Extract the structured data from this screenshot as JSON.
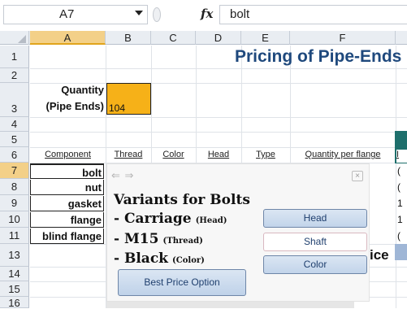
{
  "formula_bar": {
    "name_box": "A7",
    "fx_label": "fx",
    "formula_value": "bolt"
  },
  "columns": [
    "A",
    "B",
    "C",
    "D",
    "E",
    "F"
  ],
  "rows": [
    "1",
    "2",
    "3",
    "4",
    "5",
    "6",
    "7",
    "8",
    "9",
    "10",
    "11",
    "13",
    "14",
    "15",
    "16"
  ],
  "sheet": {
    "title": "Pricing of Pipe-Ends",
    "quantity_label_line1": "Quantity",
    "quantity_label_line2": "(Pipe Ends)",
    "quantity_value": "104",
    "component_headers": [
      "Component",
      "Thread",
      "Color",
      "Head",
      "Type",
      "Quantity per flange"
    ],
    "right_col_header_partial": "I",
    "components": [
      "bolt",
      "nut",
      "gasket",
      "flange",
      "blind flange"
    ],
    "right_col_digits": [
      "(",
      "(",
      "1",
      "1",
      "("
    ],
    "price_partial": "ice"
  },
  "popup": {
    "nav_arrows": "⇐ ⇒",
    "close_label": "×",
    "heading": "Variants for Bolts",
    "variants": [
      {
        "main": "- Carriage",
        "note": "(Head)"
      },
      {
        "main": "- M15",
        "note": "(Thread)"
      },
      {
        "main": "- Black",
        "note": "(Color)"
      }
    ],
    "buttons": [
      "Head",
      "Shaft",
      "Color"
    ],
    "best_price_label": "Best Price Option"
  },
  "colors": {
    "title": "#1f497d",
    "highlight": "#f6b118",
    "teal": "#1e6f6c",
    "button_blue": "#c2d4ea"
  }
}
